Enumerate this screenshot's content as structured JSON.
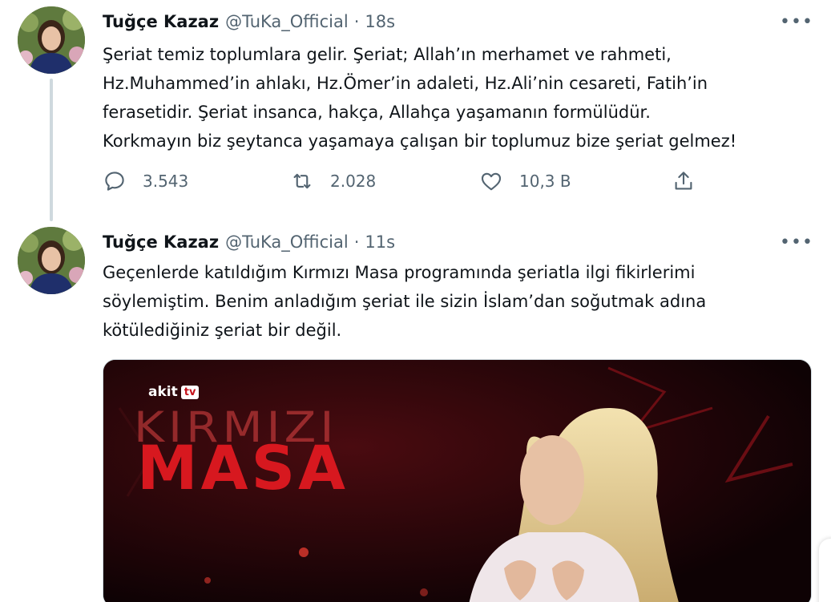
{
  "tweets": [
    {
      "author_name": "Tuğçe Kazaz",
      "handle": "@TuKa_Official",
      "separator": "·",
      "time": "18s",
      "more": "•••",
      "text_lines": [
        "Şeriat temiz toplumlara gelir. Şeriat; Allah’ın merhamet ve rahmeti,",
        "Hz.Muhammed’in ahlakı, Hz.Ömer’in adaleti, Hz.Ali’nin cesareti, Fatih’in",
        "ferasetidir. Şeriat insanca, hakça, Allahça yaşamanın formülüdür.",
        "Korkmayın biz şeytanca yaşamaya çalışan bir toplumuz bize şeriat gelmez!"
      ],
      "replies": "3.543",
      "retweets": "2.028",
      "likes": "10,3 B"
    },
    {
      "author_name": "Tuğçe Kazaz",
      "handle": "@TuKa_Official",
      "separator": "·",
      "time": "11s",
      "more": "•••",
      "text_lines": [
        "Geçenlerde katıldığım Kırmızı Masa programında şeriatla ilgi fikirlerimi",
        "söylemiştim. Benim anladığım şeriat ile sizin İslam’dan soğutmak adına",
        "kötülediğiniz şeriat bir değil."
      ],
      "media": {
        "brand": "akit",
        "brand_tv": "tv",
        "show_title_top": "KIRMIZI",
        "show_title_bottom": "MASA"
      }
    }
  ],
  "icons": {
    "reply": "reply-icon",
    "retweet": "retweet-icon",
    "like": "heart-icon",
    "share": "share-icon",
    "more": "more-icon"
  },
  "colors": {
    "text": "#0f1419",
    "secondary": "#536471",
    "thread_line": "#cfd9de",
    "media_red": "#d7181f"
  }
}
